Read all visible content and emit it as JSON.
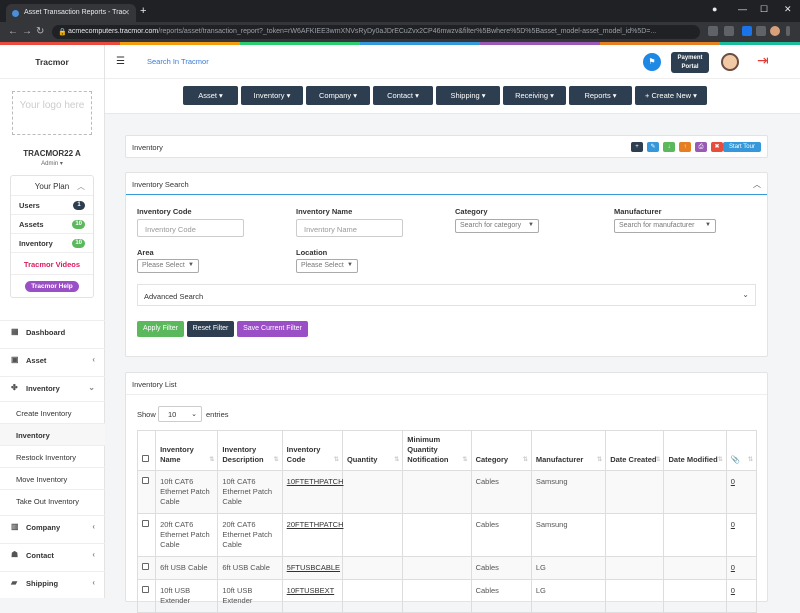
{
  "browser": {
    "tab_title": "Asset Transaction Reports - Trac",
    "url_host": "acmecomputers.tracmor.com",
    "url_path": "/reports/asset/transaction_report?_token=rW6AFKIEE3wmXNVsRyDy0aJDrECuZvx2CP46mwzv&filter%5Bwhere%5D%5Basset_model-asset_model_id%5D=..."
  },
  "sidebar": {
    "brand": "Tracmor",
    "logo_text": "Your logo here",
    "customer": "TRACMOR22 A",
    "role": "Admin ▾",
    "plan_title": "Your Plan",
    "plan_items": [
      {
        "label": "Users",
        "count": "1",
        "color": "#2c3e50"
      },
      {
        "label": "Assets",
        "count": "10",
        "color": "#5cb85c"
      },
      {
        "label": "Inventory",
        "count": "10",
        "color": "#5cb85c"
      }
    ],
    "videos": "Tracmor Videos",
    "help": "Tracmor Help",
    "nav": [
      {
        "label": "Dashboard"
      },
      {
        "label": "Asset"
      },
      {
        "label": "Inventory"
      }
    ],
    "inventory_sub": [
      "Create Inventory",
      "Inventory",
      "Restock Inventory",
      "Move Inventory",
      "Take Out Inventory"
    ],
    "nav_bottom": [
      {
        "label": "Company"
      },
      {
        "label": "Contact"
      },
      {
        "label": "Shipping"
      }
    ]
  },
  "topbar": {
    "search": "Search In Tracmor",
    "portal_line1": "Payment",
    "portal_line2": "Portal"
  },
  "menu": [
    {
      "label": "Asset ▾"
    },
    {
      "label": "Inventory ▾"
    },
    {
      "label": "Company ▾"
    },
    {
      "label": "Contact ▾"
    },
    {
      "label": "Shipping ▾"
    },
    {
      "label": "Receiving ▾"
    },
    {
      "label": "Reports ▾"
    },
    {
      "label": "+ Create New ▾"
    }
  ],
  "inventory_panel": {
    "title": "Inventory",
    "start_tour": "Start Tour"
  },
  "search_panel": {
    "title": "Inventory Search",
    "inventory_code_label": "Inventory Code",
    "inventory_code_placeholder": "Inventory Code",
    "inventory_name_label": "Inventory Name",
    "inventory_name_placeholder": "Inventory Name",
    "category_label": "Category",
    "category_value": "Search for category",
    "manufacturer_label": "Manufacturer",
    "manufacturer_value": "Search for manufacturer",
    "area_label": "Area",
    "area_value": "Please Select",
    "location_label": "Location",
    "location_value": "Please Select",
    "advanced": "Advanced Search",
    "apply": "Apply Filter",
    "reset": "Reset Filter",
    "save": "Save Current Filter"
  },
  "list_panel": {
    "title": "Inventory List",
    "show": "Show",
    "entries_value": "10",
    "entries": "entries",
    "columns": [
      "Inventory Name",
      "Inventory Description",
      "Inventory Code",
      "Quantity",
      "Minimum Quantity Notification",
      "Category",
      "Manufacturer",
      "Date Created",
      "Date Modified",
      "📎"
    ],
    "rows": [
      {
        "name": "10ft CAT6 Ethernet Patch Cable",
        "desc": "10ft CAT6 Ethernet Patch Cable",
        "code": "10FTETHPATCH",
        "qty": "",
        "min": "",
        "category": "Cables",
        "manufacturer": "Samsung",
        "created": "",
        "modified": "",
        "att": "0"
      },
      {
        "name": "20ft CAT6 Ethernet Patch Cable",
        "desc": "20ft CAT6 Ethernet Patch Cable",
        "code": "20FTETHPATCH",
        "qty": "",
        "min": "",
        "category": "Cables",
        "manufacturer": "Samsung",
        "created": "",
        "modified": "",
        "att": "0"
      },
      {
        "name": "6ft USB Cable",
        "desc": "6ft USB Cable",
        "code": "5FTUSBCABLE",
        "qty": "",
        "min": "",
        "category": "Cables",
        "manufacturer": "LG",
        "created": "",
        "modified": "",
        "att": "0"
      },
      {
        "name": "10ft USB Extender",
        "desc": "10ft USB Extender",
        "code": "10FTUSBEXT",
        "qty": "",
        "min": "",
        "category": "Cables",
        "manufacturer": "LG",
        "created": "",
        "modified": "",
        "att": "0"
      }
    ]
  }
}
